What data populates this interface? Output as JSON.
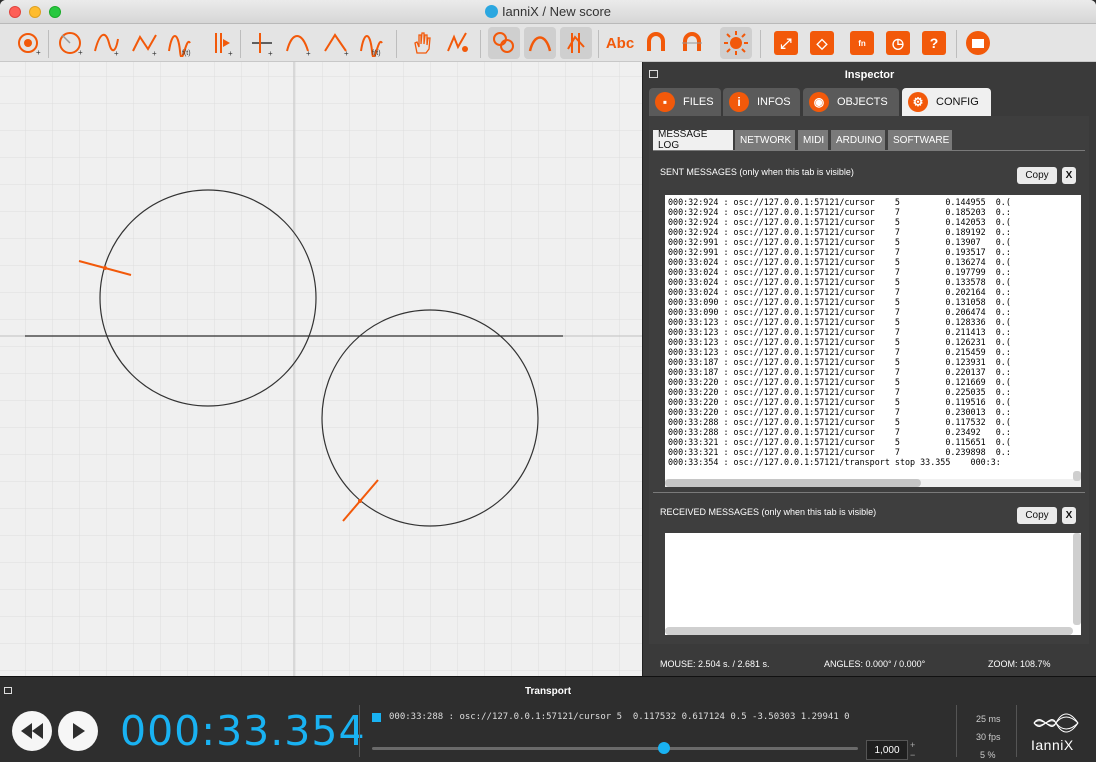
{
  "window": {
    "title": "IanniX / New score"
  },
  "toolbar": {
    "tools": [
      "add-point-tool-icon",
      "add-circle-curve-icon",
      "add-smooth-curve-icon",
      "add-straight-curve-icon",
      "add-math-curve-icon",
      "add-trigger-tool-icon",
      "add-cursor-icon",
      "add-smooth-cursor-curve-icon",
      "add-straight-cursor-curve-icon",
      "add-math-cursor-curve-icon",
      "hand-tool-icon",
      "freehand-tool-icon",
      "snap-grid-icon",
      "snap-curve-icon",
      "snap-points-icon"
    ],
    "text_tool_label": "Abc",
    "help_label": "?"
  },
  "inspector": {
    "title": "Inspector",
    "tabs": [
      {
        "label": "FILES",
        "icon": "folder-icon",
        "active": false
      },
      {
        "label": "INFOS",
        "icon": "info-icon",
        "active": false
      },
      {
        "label": "OBJECTS",
        "icon": "eye-icon",
        "active": false
      },
      {
        "label": "CONFIG",
        "icon": "config-icon",
        "active": true
      }
    ],
    "subtabs": [
      {
        "label": "MESSAGE LOG",
        "active": true
      },
      {
        "label": "NETWORK",
        "active": false
      },
      {
        "label": "MIDI",
        "active": false
      },
      {
        "label": "ARDUINO",
        "active": false
      },
      {
        "label": "SOFTWARE",
        "active": false
      }
    ],
    "sent": {
      "title": "SENT MESSAGES (only when this tab is visible)",
      "copy_label": "Copy",
      "clear_label": "X",
      "log": "000:32:924 : osc://127.0.0.1:57121/cursor    5         0.144955  0.(\n000:32:924 : osc://127.0.0.1:57121/cursor    7         0.185203  0.:\n000:32:924 : osc://127.0.0.1:57121/cursor    5         0.142053  0.(\n000:32:924 : osc://127.0.0.1:57121/cursor    7         0.189192  0.:\n000:32:991 : osc://127.0.0.1:57121/cursor    5         0.13907   0.(\n000:32:991 : osc://127.0.0.1:57121/cursor    7         0.193517  0.:\n000:33:024 : osc://127.0.0.1:57121/cursor    5         0.136274  0.(\n000:33:024 : osc://127.0.0.1:57121/cursor    7         0.197799  0.:\n000:33:024 : osc://127.0.0.1:57121/cursor    5         0.133578  0.(\n000:33:024 : osc://127.0.0.1:57121/cursor    7         0.202164  0.:\n000:33:090 : osc://127.0.0.1:57121/cursor    5         0.131058  0.(\n000:33:090 : osc://127.0.0.1:57121/cursor    7         0.206474  0.:\n000:33:123 : osc://127.0.0.1:57121/cursor    5         0.128336  0.(\n000:33:123 : osc://127.0.0.1:57121/cursor    7         0.211413  0.:\n000:33:123 : osc://127.0.0.1:57121/cursor    5         0.126231  0.(\n000:33:123 : osc://127.0.0.1:57121/cursor    7         0.215459  0.:\n000:33:187 : osc://127.0.0.1:57121/cursor    5         0.123931  0.(\n000:33:187 : osc://127.0.0.1:57121/cursor    7         0.220137  0.:\n000:33:220 : osc://127.0.0.1:57121/cursor    5         0.121669  0.(\n000:33:220 : osc://127.0.0.1:57121/cursor    7         0.225035  0.:\n000:33:220 : osc://127.0.0.1:57121/cursor    5         0.119516  0.(\n000:33:220 : osc://127.0.0.1:57121/cursor    7         0.230013  0.:\n000:33:288 : osc://127.0.0.1:57121/cursor    5         0.117532  0.(\n000:33:288 : osc://127.0.0.1:57121/cursor    7         0.23492   0.:\n000:33:321 : osc://127.0.0.1:57121/cursor    5         0.115651  0.(\n000:33:321 : osc://127.0.0.1:57121/cursor    7         0.239898  0.:\n000:33:354 : osc://127.0.0.1:57121/transport stop 33.355    000:3:"
    },
    "received": {
      "title": "RECEIVED MESSAGES (only when this tab is visible)",
      "copy_label": "Copy",
      "clear_label": "X"
    },
    "status": {
      "mouse": "MOUSE: 2.504 s. / 2.681 s.",
      "angles": "ANGLES: 0.000° / 0.000°",
      "zoom": "ZOOM: 108.7%"
    }
  },
  "transport": {
    "title": "Transport",
    "time": "000:33.354",
    "last_message": "000:33:288 : osc://127.0.0.1:57121/cursor 5  0.117532 0.617124 0.5 -3.50303 1.29941 0",
    "speed": "1,000",
    "speed_fraction": 0.6,
    "stats": {
      "latency": "25 ms",
      "fps": "30 fps",
      "cpu": "5 %"
    },
    "logo_text": "IanniX"
  },
  "colors": {
    "accent": "#f2590a",
    "timer": "#19b2f2"
  }
}
